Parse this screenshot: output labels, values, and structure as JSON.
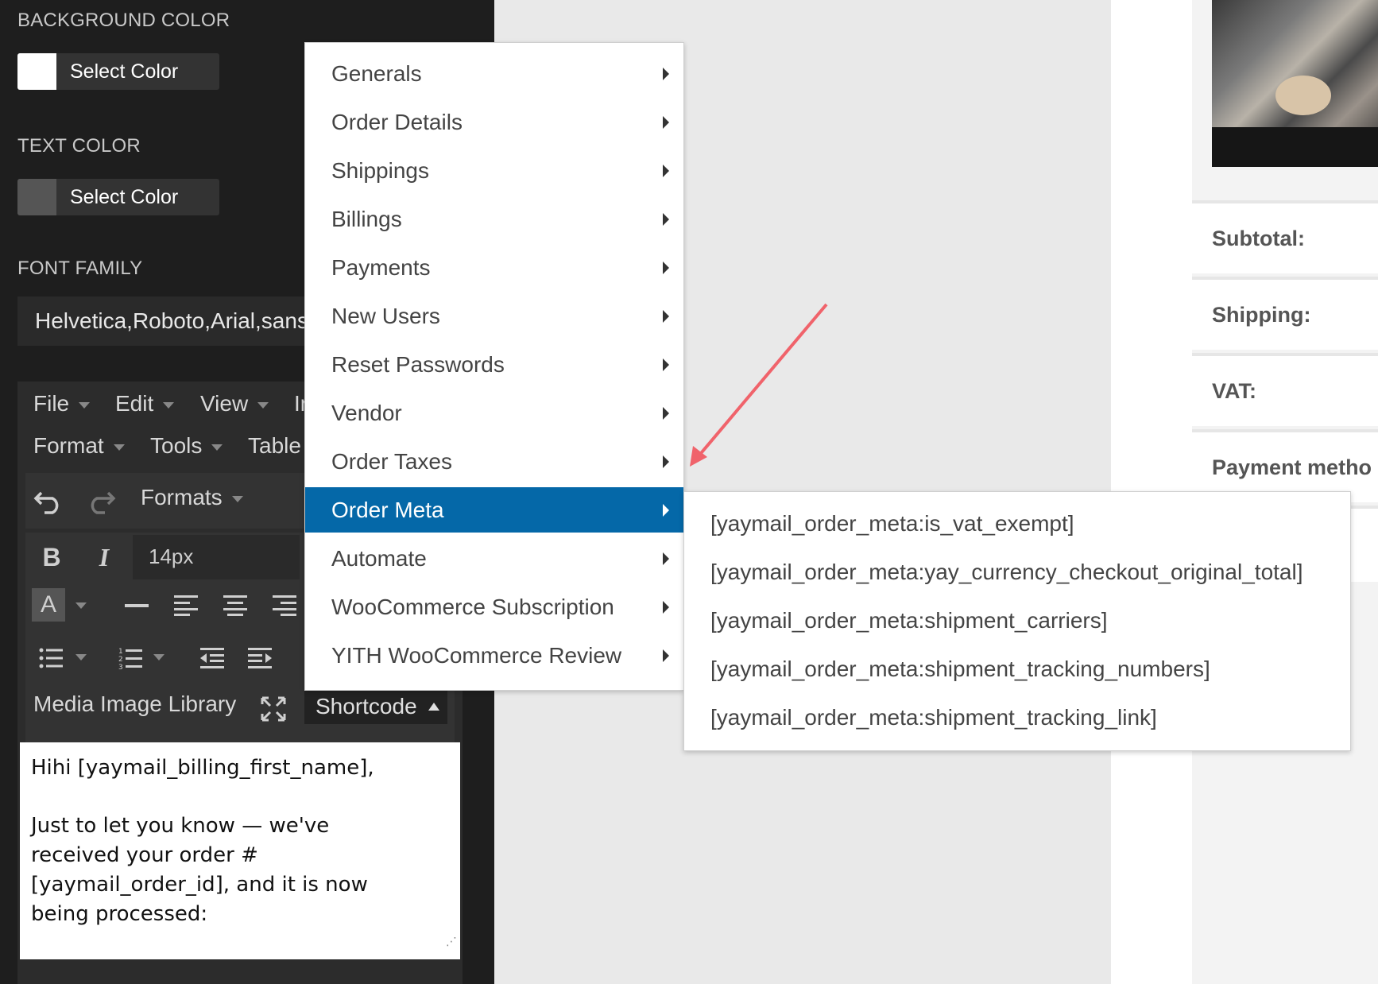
{
  "sidebar": {
    "background_color": {
      "label": "BACKGROUND COLOR",
      "button": "Select Color",
      "swatch": "#ffffff"
    },
    "text_color": {
      "label": "TEXT COLOR",
      "button": "Select Color",
      "swatch": "#555555"
    },
    "font_family": {
      "label": "FONT FAMILY",
      "value": "Helvetica,Roboto,Arial,sans"
    }
  },
  "editor": {
    "menubar": [
      "File",
      "Edit",
      "View",
      "Ir",
      "Format",
      "Tools",
      "Table"
    ],
    "formats_label": "Formats",
    "font_size": "14px",
    "media_library": "Media Image Library",
    "shortcode_button": "Shortcode",
    "content": {
      "line1": "Hihi [yaymail_billing_first_name],",
      "line2": "Just to let you know — we've",
      "line3": "received your order #",
      "line4": "[yaymail_order_id], and it is now",
      "line5": "being processed:"
    }
  },
  "shortcode_menu": {
    "items": [
      "Generals",
      "Order Details",
      "Shippings",
      "Billings",
      "Payments",
      "New Users",
      "Reset Passwords",
      "Vendor",
      "Order Taxes",
      "Order Meta",
      "Automate",
      "WooCommerce Subscription",
      "YITH WooCommerce Review"
    ],
    "active_item": "Order Meta",
    "submenu": [
      "[yaymail_order_meta:is_vat_exempt]",
      "[yaymail_order_meta:yay_currency_checkout_original_total]",
      "[yaymail_order_meta:shipment_carriers]",
      "[yaymail_order_meta:shipment_tracking_numbers]",
      "[yaymail_order_meta:shipment_tracking_link]"
    ]
  },
  "preview": {
    "rows": [
      "Subtotal:",
      "Shipping:",
      "VAT:",
      "Payment metho"
    ]
  },
  "colors": {
    "active_menu": "#0568a8",
    "annotation_arrow": "#f0636b",
    "panel_bg": "#1e1e1e"
  }
}
